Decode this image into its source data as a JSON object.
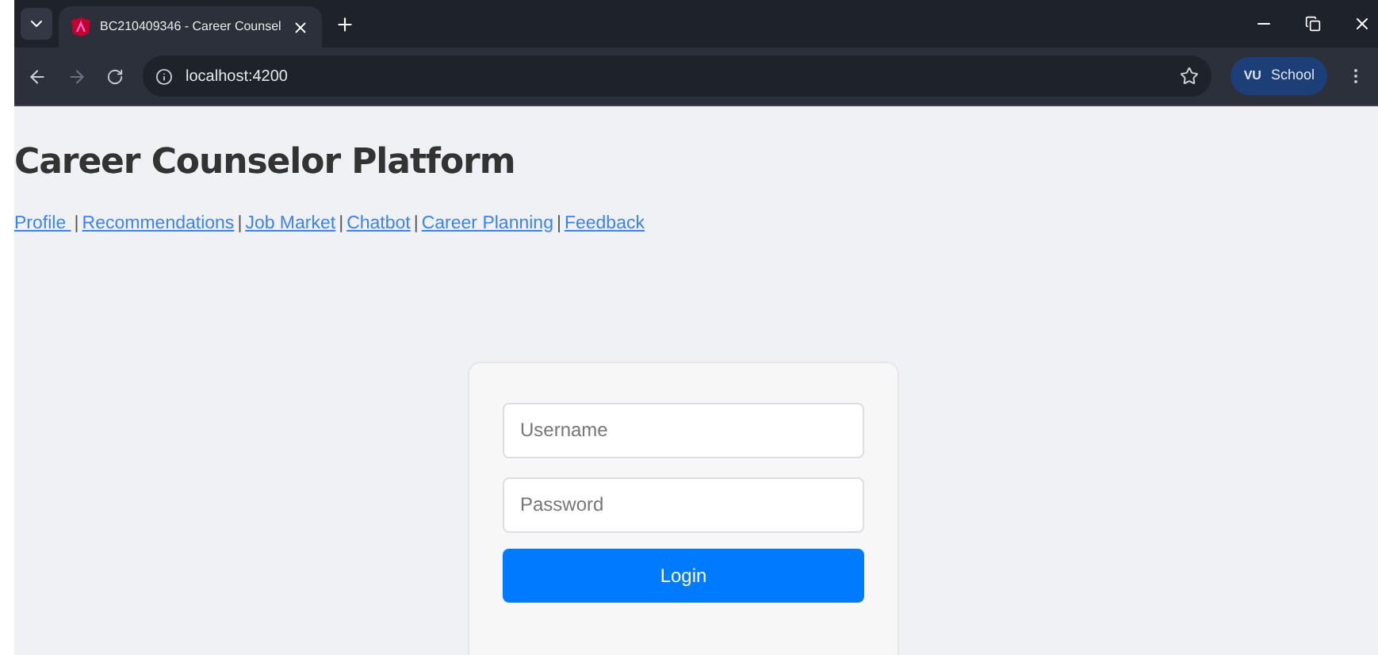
{
  "browser": {
    "tab": {
      "title": "BC210409346 - Career Counsel",
      "selected": true
    },
    "url": "localhost:4200",
    "profile": "School",
    "profile_badge": "VU"
  },
  "page": {
    "title": "Career Counselor Platform",
    "nav": [
      {
        "label": "Profile "
      },
      {
        "label": "Recommendations"
      },
      {
        "label": "Job Market"
      },
      {
        "label": "Chatbot"
      },
      {
        "label": "Career Planning"
      },
      {
        "label": "Feedback"
      }
    ],
    "separator": "|",
    "login": {
      "username": {
        "placeholder": "Username"
      },
      "password": {
        "placeholder": "Password"
      },
      "button": "Login"
    }
  }
}
